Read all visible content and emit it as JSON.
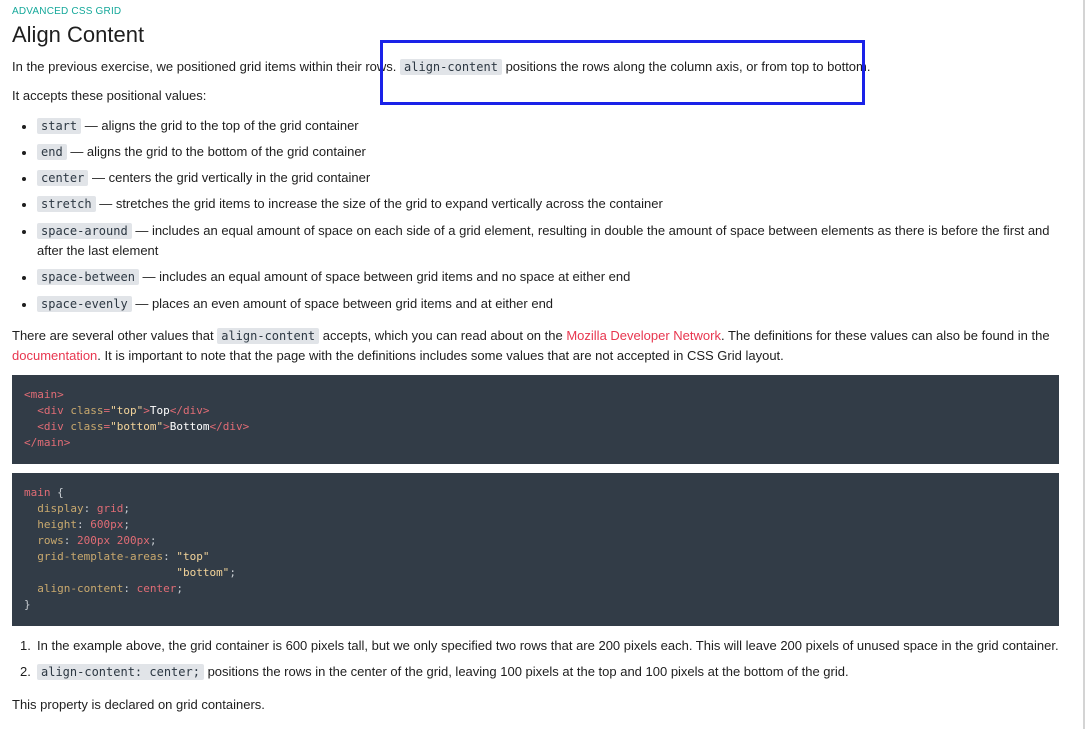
{
  "eyebrow": "ADVANCED CSS GRID",
  "title": "Align Content",
  "intro": {
    "before": "In the previous exercise, we positioned grid items within their rows.",
    "code": "align-content",
    "after": "positions the rows along the column axis, or from top to bottom."
  },
  "accepts": "It accepts these positional values:",
  "values": [
    {
      "code": "start",
      "desc": "— aligns the grid to the top of the grid container"
    },
    {
      "code": "end",
      "desc": "— aligns the grid to the bottom of the grid container"
    },
    {
      "code": "center",
      "desc": "— centers the grid vertically in the grid container"
    },
    {
      "code": "stretch",
      "desc": "— stretches the grid items to increase the size of the grid to expand vertically across the container"
    },
    {
      "code": "space-around",
      "desc": "— includes an equal amount of space on each side of a grid element, resulting in double the amount of space between elements as there is before the first and after the last element"
    },
    {
      "code": "space-between",
      "desc": "— includes an equal amount of space between grid items and no space at either end"
    },
    {
      "code": "space-evenly",
      "desc": "— places an even amount of space between grid items and at either end"
    }
  ],
  "other_values": {
    "before": "There are several other values that",
    "code": "align-content",
    "middle": "accepts, which you can read about on the",
    "link1": "Mozilla Developer Network",
    "middle2": ". The definitions for these values can also be found in the",
    "link2": "documentation",
    "after": ". It is important to note that the page with the definitions includes some values that are not accepted in CSS Grid layout."
  },
  "html_code": {
    "main_open": "<main>",
    "div1_open": "<div ",
    "div1_attr": "class",
    "div1_val": "\"top\"",
    "div1_text": "Top",
    "div_close": "</div>",
    "div2_val": "\"bottom\"",
    "div2_text": "Bottom",
    "main_close": "</main>"
  },
  "css_code": {
    "selector": "main",
    "brace_open": " {",
    "lines": [
      {
        "prop": "display",
        "val": "grid"
      },
      {
        "prop": "height",
        "val": "600px"
      },
      {
        "prop": "rows",
        "val": "200px 200px"
      },
      {
        "prop": "grid-template-areas",
        "val": "\"top\"",
        "val2": "\"bottom\""
      },
      {
        "prop": "align-content",
        "val": "center"
      }
    ],
    "brace_close": "}"
  },
  "steps": [
    {
      "num": "1.",
      "text": "In the example above, the grid container is 600 pixels tall, but we only specified two rows that are 200 pixels each. This will leave 200 pixels of unused space in the grid container."
    },
    {
      "num": "2.",
      "code": "align-content: center;",
      "text": "positions the rows in the center of the grid, leaving 100 pixels at the top and 100 pixels at the bottom of the grid."
    }
  ],
  "closing": "This property is declared on grid containers."
}
